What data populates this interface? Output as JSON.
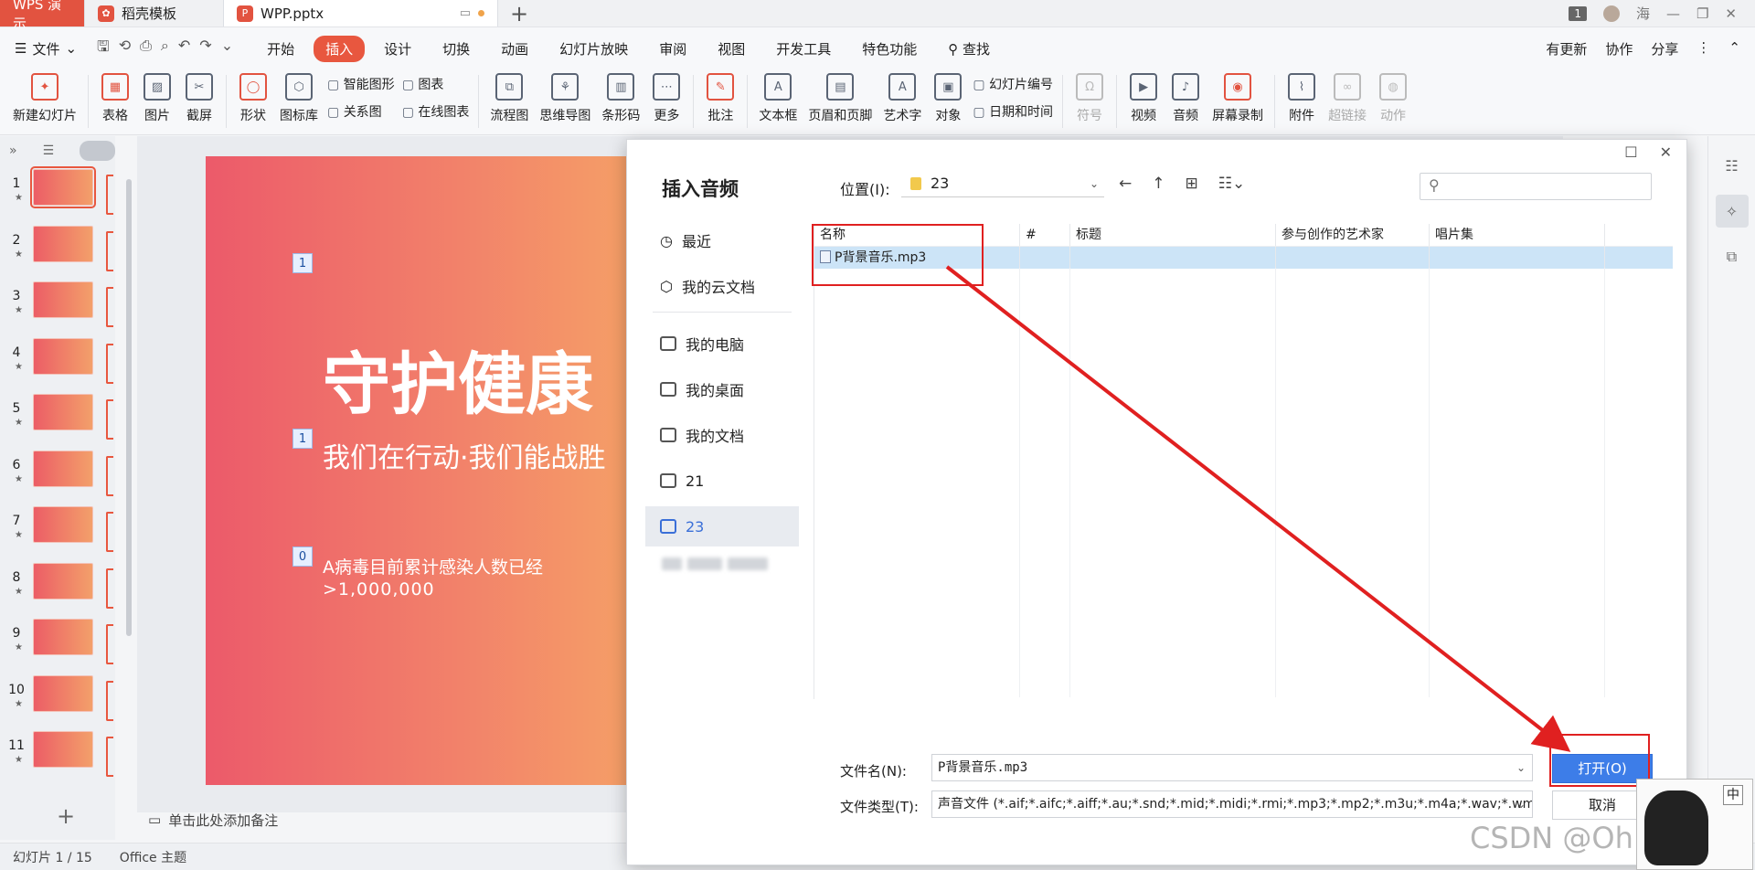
{
  "tabs": {
    "app": "WPS 演示",
    "template": "稻壳模板",
    "document": "WPP.pptx"
  },
  "titlebar": {
    "badge": "1",
    "user": "海"
  },
  "menubar": {
    "file": "文件",
    "tabs": [
      "开始",
      "插入",
      "设计",
      "切换",
      "动画",
      "幻灯片放映",
      "审阅",
      "视图",
      "开发工具",
      "特色功能"
    ],
    "active_tab": "插入",
    "search": "查找",
    "right": [
      "有更新",
      "协作",
      "分享"
    ]
  },
  "ribbon": {
    "new_slide": "新建幻灯片",
    "table": "表格",
    "picture": "图片",
    "screenshot": "截屏",
    "shape": "形状",
    "icon_lib": "图标库",
    "smart_shape": "智能图形",
    "chart": "图表",
    "relation": "关系图",
    "online_chart": "在线图表",
    "flowchart": "流程图",
    "mindmap": "思维导图",
    "barcode": "条形码",
    "more": "更多",
    "comment": "批注",
    "textbox": "文本框",
    "header_footer": "页眉和页脚",
    "wordart": "艺术字",
    "object": "对象",
    "slide_number": "幻灯片编号",
    "datetime": "日期和时间",
    "symbol": "符号",
    "video": "视频",
    "audio": "音频",
    "screen_record": "屏幕录制",
    "attachment": "附件",
    "hyperlink": "超链接",
    "action": "动作"
  },
  "slides": [
    "1",
    "2",
    "3",
    "4",
    "5",
    "6",
    "7",
    "8",
    "9",
    "10",
    "11"
  ],
  "slide": {
    "title": "守护健康",
    "subtitle": "我们在行动·我们能战胜",
    "stat_line1": "A病毒目前累计感染人数已经",
    "stat_line2": ">1,000,000",
    "tag1": "1",
    "tag2": "1",
    "tag3": "0"
  },
  "notes": "单击此处添加备注",
  "status": {
    "slide_info": "幻灯片 1 / 15",
    "theme": "Office 主题"
  },
  "dialog": {
    "title": "插入音频",
    "nav": [
      "最近",
      "我的云文档",
      "我的电脑",
      "我的桌面",
      "我的文档",
      "21",
      "23"
    ],
    "location_label": "位置(I):",
    "location_value": "23",
    "columns": [
      "名称",
      "#",
      "标题",
      "参与创作的艺术家",
      "唱片集"
    ],
    "files": [
      {
        "name": "P背景音乐.mp3"
      }
    ],
    "filename_label": "文件名(N):",
    "filename_value": "P背景音乐.mp3",
    "filetype_label": "文件类型(T):",
    "filetype_value": "声音文件 (*.aif;*.aifc;*.aiff;*.au;*.snd;*.mid;*.midi;*.rmi;*.mp3;*.mp2;*.m3u;*.m4a;*.wav;*.wma;*.",
    "open_button": "打开(O)",
    "cancel_button": "取消"
  },
  "watermark": "CSDN @Oh Correct",
  "ime": {
    "label": "中"
  },
  "colors": {
    "accent": "#e8573f",
    "primary_button": "#3d7de8",
    "annotation": "#e02020"
  }
}
